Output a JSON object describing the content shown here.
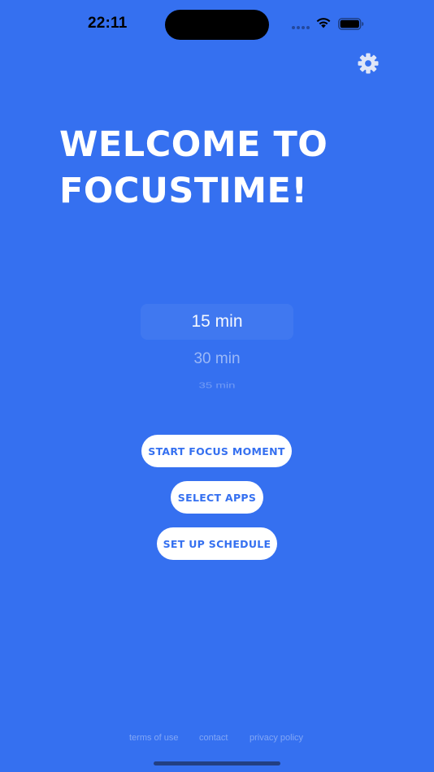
{
  "status_bar": {
    "time": "22:11",
    "icons": [
      "signal-dots-icon",
      "wifi-icon",
      "battery-icon"
    ]
  },
  "header": {
    "settings_icon": "gear-icon"
  },
  "main": {
    "title": "WELCOME TO FOCUSTIME!",
    "duration_picker": {
      "selected": "15 min",
      "options": [
        "15 min",
        "30 min",
        "35 min"
      ]
    },
    "buttons": {
      "start_label": "START FOCUS MOMENT",
      "select_apps_label": "SELECT APPS",
      "schedule_label": "SET UP SCHEDULE"
    }
  },
  "footer": {
    "terms_label": "terms of use",
    "contact_label": "contact",
    "privacy_label": "privacy policy"
  },
  "colors": {
    "background": "#3570F0",
    "button_bg": "#FFFFFF",
    "button_text": "#3570F0"
  }
}
